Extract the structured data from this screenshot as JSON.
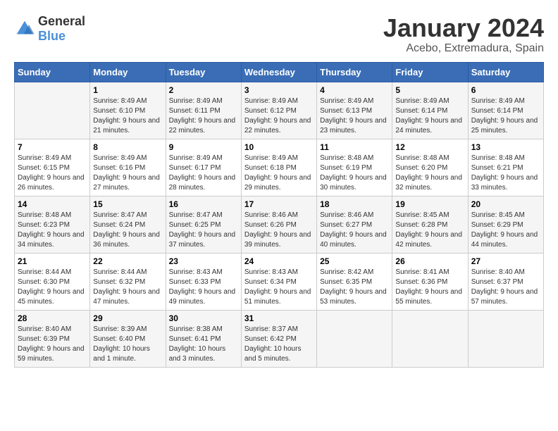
{
  "logo": {
    "general": "General",
    "blue": "Blue"
  },
  "title": "January 2024",
  "subtitle": "Acebo, Extremadura, Spain",
  "days_header": [
    "Sunday",
    "Monday",
    "Tuesday",
    "Wednesday",
    "Thursday",
    "Friday",
    "Saturday"
  ],
  "weeks": [
    [
      {
        "day": "",
        "sunrise": "",
        "sunset": "",
        "daylight": ""
      },
      {
        "day": "1",
        "sunrise": "Sunrise: 8:49 AM",
        "sunset": "Sunset: 6:10 PM",
        "daylight": "Daylight: 9 hours and 21 minutes."
      },
      {
        "day": "2",
        "sunrise": "Sunrise: 8:49 AM",
        "sunset": "Sunset: 6:11 PM",
        "daylight": "Daylight: 9 hours and 22 minutes."
      },
      {
        "day": "3",
        "sunrise": "Sunrise: 8:49 AM",
        "sunset": "Sunset: 6:12 PM",
        "daylight": "Daylight: 9 hours and 22 minutes."
      },
      {
        "day": "4",
        "sunrise": "Sunrise: 8:49 AM",
        "sunset": "Sunset: 6:13 PM",
        "daylight": "Daylight: 9 hours and 23 minutes."
      },
      {
        "day": "5",
        "sunrise": "Sunrise: 8:49 AM",
        "sunset": "Sunset: 6:14 PM",
        "daylight": "Daylight: 9 hours and 24 minutes."
      },
      {
        "day": "6",
        "sunrise": "Sunrise: 8:49 AM",
        "sunset": "Sunset: 6:14 PM",
        "daylight": "Daylight: 9 hours and 25 minutes."
      }
    ],
    [
      {
        "day": "7",
        "sunrise": "Sunrise: 8:49 AM",
        "sunset": "Sunset: 6:15 PM",
        "daylight": "Daylight: 9 hours and 26 minutes."
      },
      {
        "day": "8",
        "sunrise": "Sunrise: 8:49 AM",
        "sunset": "Sunset: 6:16 PM",
        "daylight": "Daylight: 9 hours and 27 minutes."
      },
      {
        "day": "9",
        "sunrise": "Sunrise: 8:49 AM",
        "sunset": "Sunset: 6:17 PM",
        "daylight": "Daylight: 9 hours and 28 minutes."
      },
      {
        "day": "10",
        "sunrise": "Sunrise: 8:49 AM",
        "sunset": "Sunset: 6:18 PM",
        "daylight": "Daylight: 9 hours and 29 minutes."
      },
      {
        "day": "11",
        "sunrise": "Sunrise: 8:48 AM",
        "sunset": "Sunset: 6:19 PM",
        "daylight": "Daylight: 9 hours and 30 minutes."
      },
      {
        "day": "12",
        "sunrise": "Sunrise: 8:48 AM",
        "sunset": "Sunset: 6:20 PM",
        "daylight": "Daylight: 9 hours and 32 minutes."
      },
      {
        "day": "13",
        "sunrise": "Sunrise: 8:48 AM",
        "sunset": "Sunset: 6:21 PM",
        "daylight": "Daylight: 9 hours and 33 minutes."
      }
    ],
    [
      {
        "day": "14",
        "sunrise": "Sunrise: 8:48 AM",
        "sunset": "Sunset: 6:23 PM",
        "daylight": "Daylight: 9 hours and 34 minutes."
      },
      {
        "day": "15",
        "sunrise": "Sunrise: 8:47 AM",
        "sunset": "Sunset: 6:24 PM",
        "daylight": "Daylight: 9 hours and 36 minutes."
      },
      {
        "day": "16",
        "sunrise": "Sunrise: 8:47 AM",
        "sunset": "Sunset: 6:25 PM",
        "daylight": "Daylight: 9 hours and 37 minutes."
      },
      {
        "day": "17",
        "sunrise": "Sunrise: 8:46 AM",
        "sunset": "Sunset: 6:26 PM",
        "daylight": "Daylight: 9 hours and 39 minutes."
      },
      {
        "day": "18",
        "sunrise": "Sunrise: 8:46 AM",
        "sunset": "Sunset: 6:27 PM",
        "daylight": "Daylight: 9 hours and 40 minutes."
      },
      {
        "day": "19",
        "sunrise": "Sunrise: 8:45 AM",
        "sunset": "Sunset: 6:28 PM",
        "daylight": "Daylight: 9 hours and 42 minutes."
      },
      {
        "day": "20",
        "sunrise": "Sunrise: 8:45 AM",
        "sunset": "Sunset: 6:29 PM",
        "daylight": "Daylight: 9 hours and 44 minutes."
      }
    ],
    [
      {
        "day": "21",
        "sunrise": "Sunrise: 8:44 AM",
        "sunset": "Sunset: 6:30 PM",
        "daylight": "Daylight: 9 hours and 45 minutes."
      },
      {
        "day": "22",
        "sunrise": "Sunrise: 8:44 AM",
        "sunset": "Sunset: 6:32 PM",
        "daylight": "Daylight: 9 hours and 47 minutes."
      },
      {
        "day": "23",
        "sunrise": "Sunrise: 8:43 AM",
        "sunset": "Sunset: 6:33 PM",
        "daylight": "Daylight: 9 hours and 49 minutes."
      },
      {
        "day": "24",
        "sunrise": "Sunrise: 8:43 AM",
        "sunset": "Sunset: 6:34 PM",
        "daylight": "Daylight: 9 hours and 51 minutes."
      },
      {
        "day": "25",
        "sunrise": "Sunrise: 8:42 AM",
        "sunset": "Sunset: 6:35 PM",
        "daylight": "Daylight: 9 hours and 53 minutes."
      },
      {
        "day": "26",
        "sunrise": "Sunrise: 8:41 AM",
        "sunset": "Sunset: 6:36 PM",
        "daylight": "Daylight: 9 hours and 55 minutes."
      },
      {
        "day": "27",
        "sunrise": "Sunrise: 8:40 AM",
        "sunset": "Sunset: 6:37 PM",
        "daylight": "Daylight: 9 hours and 57 minutes."
      }
    ],
    [
      {
        "day": "28",
        "sunrise": "Sunrise: 8:40 AM",
        "sunset": "Sunset: 6:39 PM",
        "daylight": "Daylight: 9 hours and 59 minutes."
      },
      {
        "day": "29",
        "sunrise": "Sunrise: 8:39 AM",
        "sunset": "Sunset: 6:40 PM",
        "daylight": "Daylight: 10 hours and 1 minute."
      },
      {
        "day": "30",
        "sunrise": "Sunrise: 8:38 AM",
        "sunset": "Sunset: 6:41 PM",
        "daylight": "Daylight: 10 hours and 3 minutes."
      },
      {
        "day": "31",
        "sunrise": "Sunrise: 8:37 AM",
        "sunset": "Sunset: 6:42 PM",
        "daylight": "Daylight: 10 hours and 5 minutes."
      },
      {
        "day": "",
        "sunrise": "",
        "sunset": "",
        "daylight": ""
      },
      {
        "day": "",
        "sunrise": "",
        "sunset": "",
        "daylight": ""
      },
      {
        "day": "",
        "sunrise": "",
        "sunset": "",
        "daylight": ""
      }
    ]
  ]
}
